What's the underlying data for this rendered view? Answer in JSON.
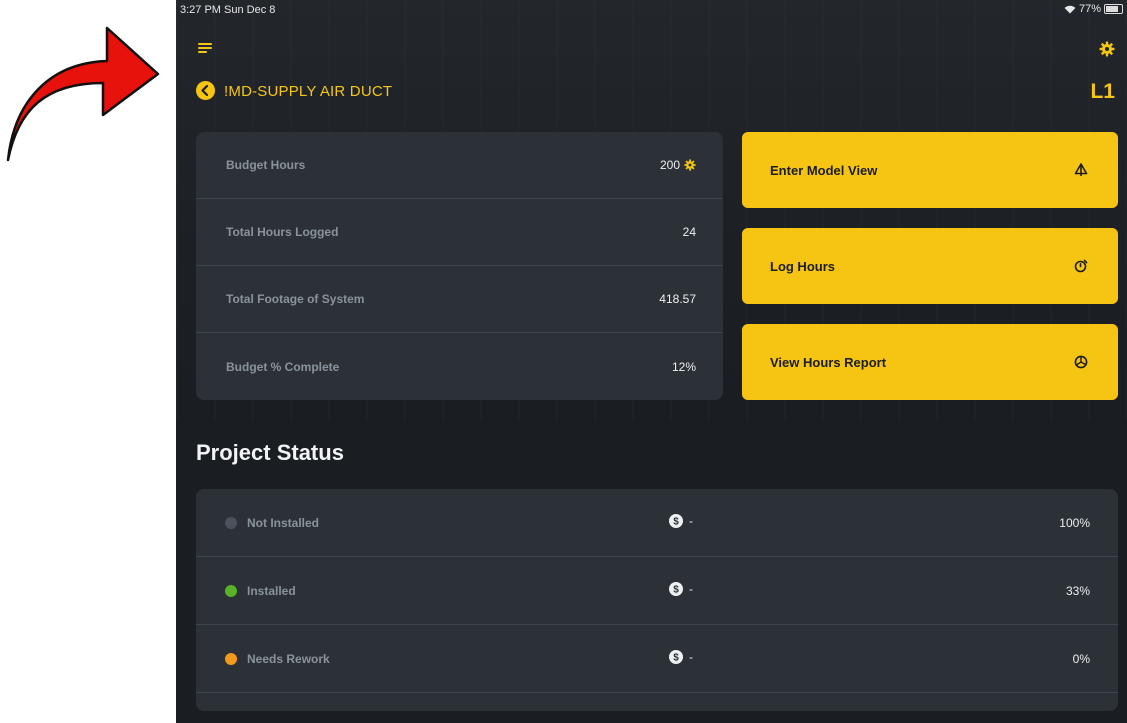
{
  "status_bar": {
    "time": "3:27 PM  Sun Dec 8",
    "battery": "77%"
  },
  "header": {
    "title": "!MD-SUPPLY AIR DUCT",
    "level": "L1"
  },
  "stats": [
    {
      "label": "Budget Hours",
      "value": "200",
      "has_gear": true
    },
    {
      "label": "Total Hours Logged",
      "value": "24"
    },
    {
      "label": "Total Footage of System",
      "value": "418.57"
    },
    {
      "label": "Budget % Complete",
      "value": "12%"
    }
  ],
  "actions": [
    {
      "label": "Enter Model View",
      "icon": "model-view-icon"
    },
    {
      "label": "Log Hours",
      "icon": "timer-icon"
    },
    {
      "label": "View Hours Report",
      "icon": "report-chart-icon"
    }
  ],
  "project_status": {
    "title": "Project Status",
    "rows": [
      {
        "label": "Not Installed",
        "cost": "-",
        "percent": "100%",
        "color": "#4a525c"
      },
      {
        "label": "Installed",
        "cost": "-",
        "percent": "33%",
        "color": "#58b327"
      },
      {
        "label": "Needs Rework",
        "cost": "-",
        "percent": "0%",
        "color": "#f39a1b"
      }
    ]
  },
  "colors": {
    "accent": "#f6c513",
    "background": "#1a1e23",
    "card": "#2b3137",
    "annotation_arrow": "#e8120c"
  }
}
